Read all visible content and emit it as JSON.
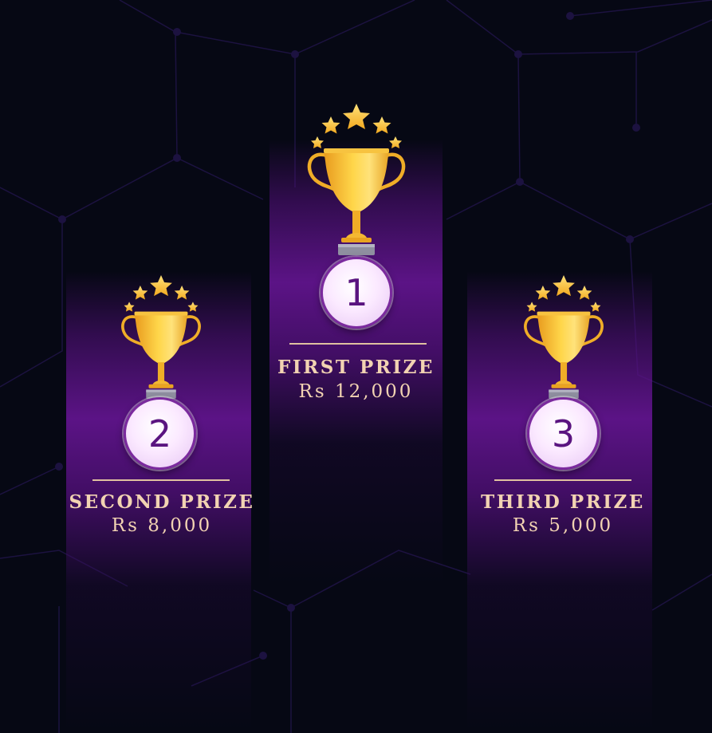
{
  "colors": {
    "background": "#060814",
    "column_purple": "#60148c",
    "gold": "#f5b830",
    "text": "#f2d3b2",
    "medal_border": "#7b2a9e",
    "medal_number": "#5a1480"
  },
  "prizes": [
    {
      "rank": "1",
      "title": "FIRST PRIZE",
      "amount": "Rs 12,000",
      "icon": "trophy-icon"
    },
    {
      "rank": "2",
      "title": "SECOND PRIZE",
      "amount": "Rs 8,000",
      "icon": "trophy-icon"
    },
    {
      "rank": "3",
      "title": "THIRD PRIZE",
      "amount": "Rs 5,000",
      "icon": "trophy-icon"
    }
  ]
}
